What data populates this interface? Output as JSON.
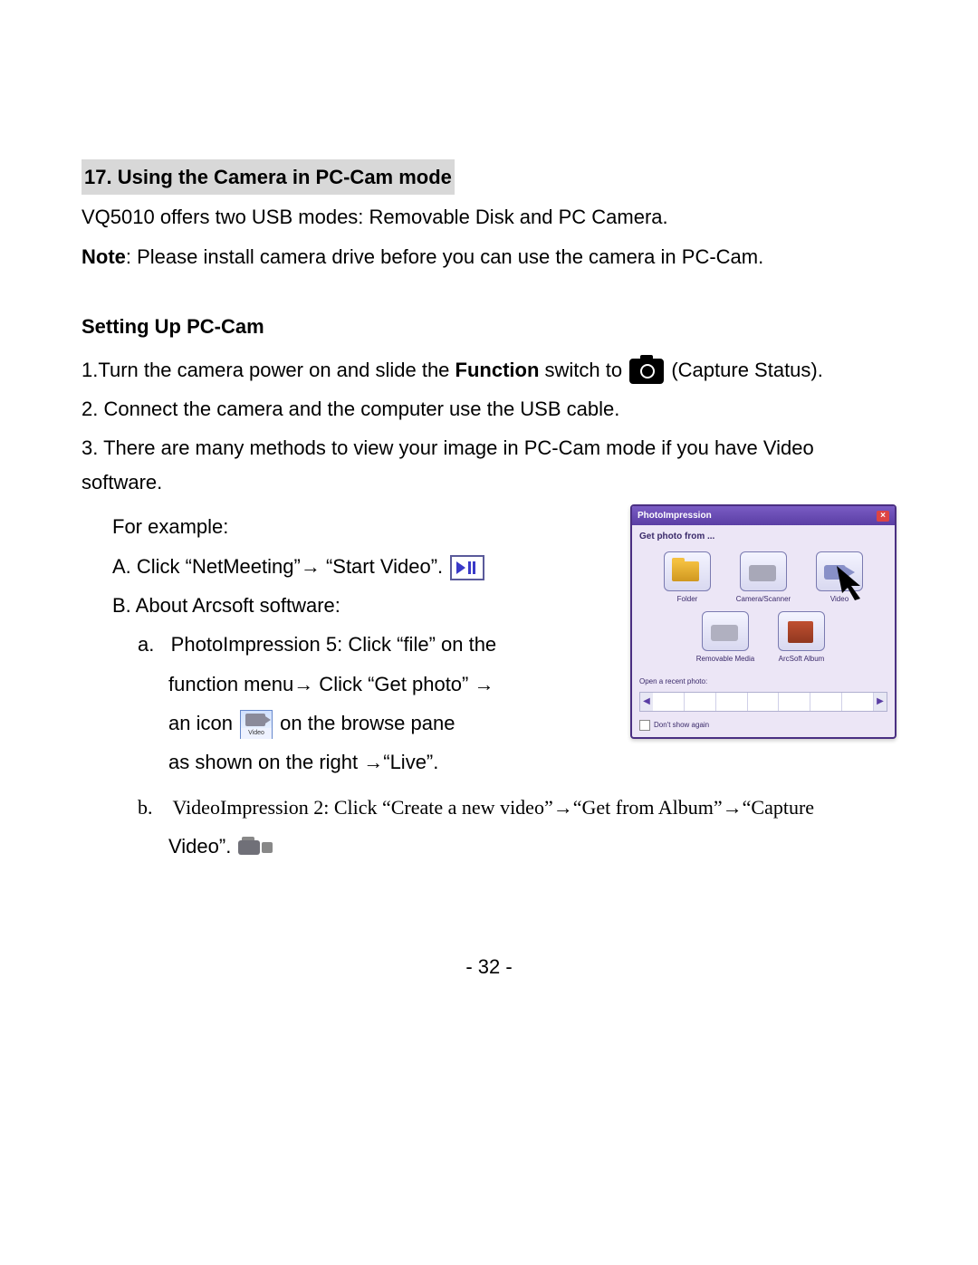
{
  "section": {
    "number": "17.",
    "title": "Using the Camera in PC-Cam mode"
  },
  "intro": {
    "line1": "VQ5010 offers two USB modes: Removable Disk and PC Camera.",
    "noteLabel": "Note",
    "noteText": ": Please install camera drive before you can use the camera in PC-Cam."
  },
  "subheading": "Setting Up PC-Cam",
  "steps": {
    "s1a": "1.Turn the camera power on and slide the ",
    "s1b": "Function",
    "s1c": " switch to ",
    "s1d": " (Capture Status).",
    "s2": "2. Connect the camera and the computer use the USB cable.",
    "s3a": "3. There are many methods to view your image in PC-Cam mode if you have Video software.",
    "s3b": "For example:",
    "A": "A. Click “NetMeeting”→ “Start Video”. ",
    "B": "B. About Arcsoft software:",
    "a1": "a.   PhotoImpression 5: Click “file” on the",
    "a2": "function menu→ Click “Get photo” →",
    "a3a": "an icon ",
    "a3b": " on the browse pane",
    "a4": "as shown on the right →“Live”.",
    "b1": "b.    VideoImpression 2: Click “Create a new video”→“Get from Album”→“Capture",
    "b2": "Video”. "
  },
  "dialog": {
    "title": "PhotoImpression",
    "sub": "Get photo from ...",
    "items": {
      "folder": "Folder",
      "camera": "Camera/Scanner",
      "video": "Video",
      "removable": "Removable Media",
      "album": "ArcSoft Album"
    },
    "recent": "Open a recent photo:",
    "dontshow": "Don't show again"
  },
  "pageNumber": "- 32 -"
}
